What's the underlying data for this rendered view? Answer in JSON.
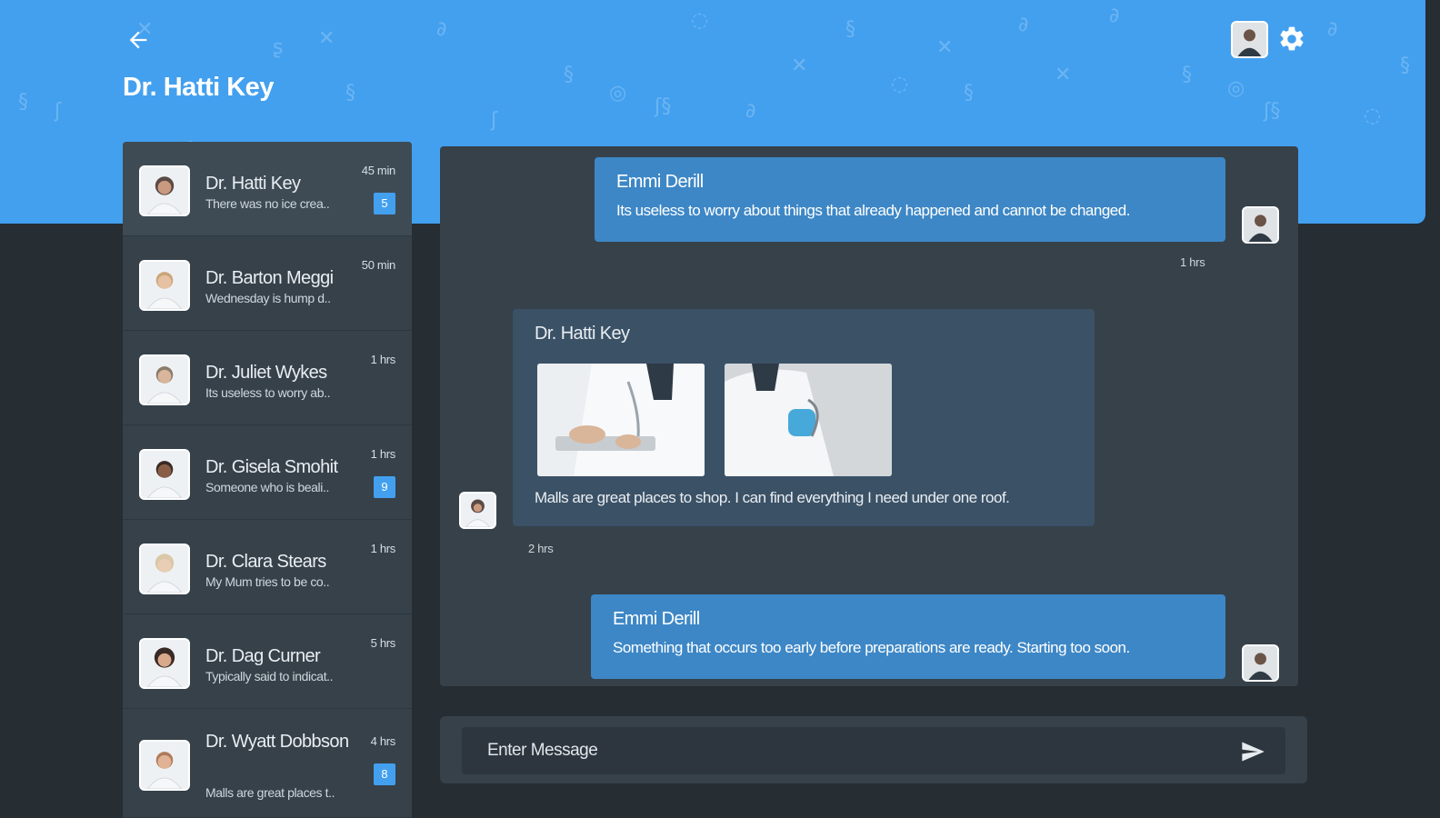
{
  "header": {
    "title": "Dr. Hatti Key"
  },
  "contacts": [
    {
      "name": "Dr. Hatti Key",
      "preview": "There was no ice crea..",
      "time": "45 min",
      "badge": "5",
      "avatar_color": "#5b4a45"
    },
    {
      "name": "Dr. Barton Meggi",
      "preview": "Wednesday is hump d..",
      "time": "50 min",
      "badge": "",
      "avatar_color": "#caa67a"
    },
    {
      "name": "Dr. Juliet Wykes",
      "preview": "Its useless to worry ab..",
      "time": "1 hrs",
      "badge": "",
      "avatar_color": "#8a7b6c"
    },
    {
      "name": "Dr. Gisela Smohit",
      "preview": "Someone who is beali..",
      "time": "1 hrs",
      "badge": "9",
      "avatar_color": "#6b4e3d"
    },
    {
      "name": "Dr. Clara Stears",
      "preview": "My Mum tries to be co..",
      "time": "1 hrs",
      "badge": "",
      "avatar_color": "#d9c9a8"
    },
    {
      "name": "Dr. Dag Curner",
      "preview": "Typically said to indicat..",
      "time": "5 hrs",
      "badge": "",
      "avatar_color": "#3a2a25"
    },
    {
      "name": "Dr. Wyatt Dobbson",
      "preview": "Malls are great places t..",
      "time": "4 hrs",
      "badge": "8",
      "avatar_color": "#b07a5a"
    }
  ],
  "messages": [
    {
      "sender": "Emmi Derill",
      "text": "Its useless to worry about things that already happened and cannot be changed.",
      "time": "1 hrs",
      "direction": "out"
    },
    {
      "sender": "Dr. Hatti Key",
      "text": "Malls are great places to shop. I can find everything I need under one roof.",
      "time": "2 hrs",
      "direction": "in"
    },
    {
      "sender": "Emmi Derill",
      "text": "Something that occurs too early before preparations are ready. Starting too soon.",
      "time": "",
      "direction": "out"
    }
  ],
  "composer": {
    "placeholder": "Enter Message"
  },
  "icons": {
    "back": "arrow-left-icon",
    "settings": "gear-icon",
    "send": "send-icon"
  },
  "colors": {
    "accent": "#43a0ef",
    "outgoing_bubble": "#3d87c6",
    "incoming_bubble": "#3b5166",
    "panel": "#36414a",
    "background": "#262d33"
  }
}
